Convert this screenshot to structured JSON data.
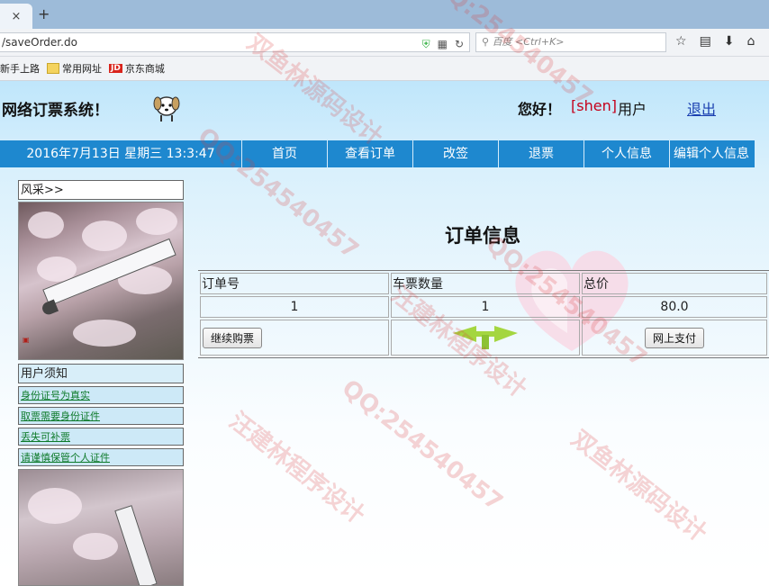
{
  "browser": {
    "tab_close": "×",
    "new_tab": "+",
    "url": "/saveOrder.do",
    "search_placeholder": "百度 <Ctrl+K>",
    "bookmarks": [
      "新手上路",
      "常用网址",
      "京东商城"
    ],
    "jd_badge": "JD"
  },
  "header": {
    "site_title": "网络订票系统！",
    "greeting": "您好！",
    "username": "[shen]",
    "user_suffix": "用户",
    "logout": "退出"
  },
  "menu": {
    "datetime": "2016年7月13日 星期三 13:3:47",
    "items": [
      "首页",
      "查看订单",
      "改签",
      "退票",
      "个人信息",
      "编辑个人信息"
    ]
  },
  "sidebar": {
    "gallery_title": "风采>>",
    "notice_title": "用户须知",
    "notices": [
      "身份证号为真实",
      "取票需要身份证件",
      "丢失可补票",
      "请谨慎保管个人证件"
    ]
  },
  "main": {
    "title": "订单信息",
    "columns": [
      "订单号",
      "车票数量",
      "总价"
    ],
    "row": [
      "1",
      "1",
      "80.0"
    ],
    "continue_button": "继续购票",
    "pay_button": "网上支付"
  },
  "watermark": {
    "qq": "QQ:254540457",
    "studio": "双鱼林源码设计",
    "designer": "汪建林程序设计"
  },
  "colors": {
    "menu_bg": "#1e88cf",
    "username": "#c4001a",
    "notice_link": "#0d7a2a"
  }
}
